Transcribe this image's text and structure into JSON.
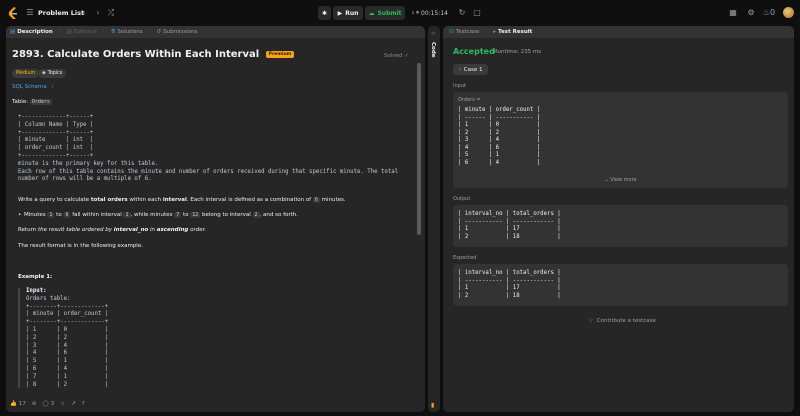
{
  "topbar": {
    "title": "Problem List",
    "run_label": "Run",
    "submit_label": "Submit",
    "timer": "00:15:14",
    "streak": "0"
  },
  "left": {
    "tabs": [
      {
        "label": "Description"
      },
      {
        "label": "Editorial"
      },
      {
        "label": "Solutions"
      },
      {
        "label": "Submissions"
      }
    ],
    "title": "2893. Calculate Orders Within Each Interval",
    "premium": "Premium",
    "solved": "Solved",
    "difficulty": "Medium",
    "topics": "Topics",
    "schema_link": "SQL Schema",
    "table_prefix": "Table: ",
    "table_name": "Orders",
    "schema_pre": "+-------------+------+\n| Column Name | Type |\n+-------------+------+\n| minute      | int  |\n| order_count | int  |\n+-------------+------+\nminute is the primary key for this table.\nEach row of this table contains the minute and number of orders received during that specific minute. The total\nnumber of rows will be a multiple of 6.",
    "q1_a": "Write a query to calculate ",
    "q1_b": "total orders",
    "q1_c": " within each ",
    "q1_d": "interval",
    "q1_e": ". Each interval is defined as a combination of ",
    "q1_f": "6",
    "q1_g": " minutes.",
    "b_a": "Minutes ",
    "b_b": "1",
    "b_c": " to ",
    "b_d": "6",
    "b_e": " fall within interval ",
    "b_f": "1",
    "b_g": ", while minutes ",
    "b_h": "7",
    "b_i": " to ",
    "b_j": "12",
    "b_k": " belong to interval ",
    "b_l": "2",
    "b_m": ", and so forth.",
    "ret_a": "Return ",
    "ret_b": "the result table ordered by ",
    "ret_c": "interval_no",
    "ret_d": " in ",
    "ret_e": "ascending",
    "ret_f": " order.",
    "format": "The result format is in the following example.",
    "example_label": "Example 1:",
    "input_label": "Input:",
    "example_pre": "Orders table:\n+--------+-------------+\n| minute | order_count |\n+--------+-------------+\n| 1      | 0           |\n| 2      | 2           |\n| 3      | 4           |\n| 4      | 6           |\n| 5      | 1           |\n| 6      | 4           |\n| 7      | 1           |\n| 8      | 2           |",
    "likes": "17",
    "comments": "3"
  },
  "mid": {
    "label": "Code"
  },
  "right": {
    "tabs": [
      {
        "label": "Testcase"
      },
      {
        "label": "Test Result"
      }
    ],
    "accepted": "Accepted",
    "runtime": "Runtime: 235 ms",
    "case": "Case 1",
    "input_label": "Input",
    "orders_label": "Orders =",
    "input_pre": "| minute | order_count |\n| ------ | ----------- |\n| 1      | 0           |\n| 2      | 2           |\n| 3      | 4           |\n| 4      | 6           |\n| 5      | 1           |\n| 6      | 4           |",
    "view_more": "View more",
    "output_label": "Output",
    "output_pre": "| interval_no | total_orders |\n| ----------- | ------------ |\n| 1           | 17           |\n| 2           | 18           |",
    "expected_label": "Expected",
    "expected_pre": "| interval_no | total_orders |\n| ----------- | ------------ |\n| 1           | 17           |\n| 2           | 18           |",
    "contribute": "Contribute a testcase"
  }
}
